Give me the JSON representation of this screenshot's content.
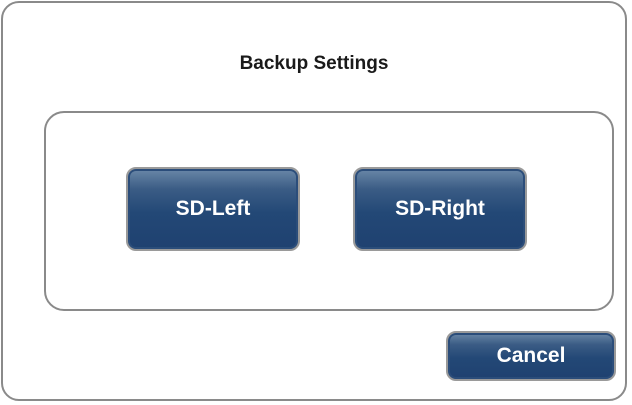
{
  "dialog": {
    "title": "Backup Settings",
    "buttons": {
      "sd_left": "SD-Left",
      "sd_right": "SD-Right",
      "cancel": "Cancel"
    }
  },
  "colors": {
    "button_fill": "#234876",
    "button_border": "#9a9a9a",
    "panel_border": "#8a8a8a",
    "title_text": "#1a1a1a"
  }
}
